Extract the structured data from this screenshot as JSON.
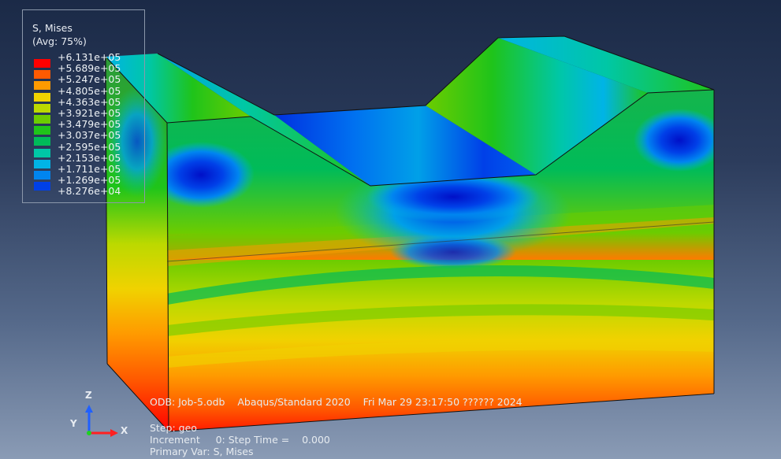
{
  "legend": {
    "title_line1": "S, Mises",
    "title_line2": "(Avg: 75%)",
    "entries": [
      {
        "value": "+6.131e+05",
        "color": "#ff0000"
      },
      {
        "value": "+5.689e+05",
        "color": "#ff5a00"
      },
      {
        "value": "+5.247e+05",
        "color": "#ff9a00"
      },
      {
        "value": "+4.805e+05",
        "color": "#f0d200"
      },
      {
        "value": "+4.363e+05",
        "color": "#bcd900"
      },
      {
        "value": "+3.921e+05",
        "color": "#6ccc00"
      },
      {
        "value": "+3.479e+05",
        "color": "#1fc41a"
      },
      {
        "value": "+3.037e+05",
        "color": "#00bb59"
      },
      {
        "value": "+2.595e+05",
        "color": "#00c7a6"
      },
      {
        "value": "+2.153e+05",
        "color": "#00b4e6"
      },
      {
        "value": "+1.711e+05",
        "color": "#0085f0"
      },
      {
        "value": "+1.269e+05",
        "color": "#0040e8"
      },
      {
        "value": "+8.276e+04",
        "color": "#0010c8"
      }
    ]
  },
  "info": {
    "odb_line": "ODB: Job-5.odb    Abaqus/Standard 2020    Fri Mar 29 23:17:50 ?????? 2024",
    "step_line": "Step: geo",
    "increment_line": "Increment     0: Step Time =    0.000",
    "primary_var_line": "Primary Var: S, Mises"
  },
  "triad": {
    "z_label": "Z",
    "y_label": "Y",
    "x_label": "X"
  }
}
